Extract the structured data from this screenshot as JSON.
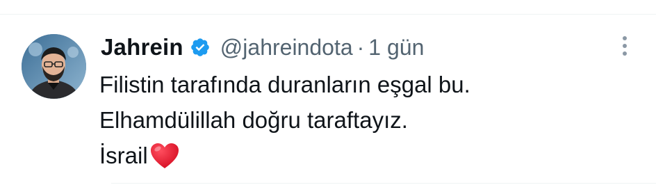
{
  "tweet": {
    "display_name": "Jahrein",
    "handle": "@jahreindota",
    "separator": "·",
    "timestamp": "1 gün",
    "verified": true,
    "verified_color": "#1d9bf0",
    "lines": [
      "Filistin tarafında duranların eşgal bu.",
      "Elhamdülillah doğru taraftayız.",
      "İsrail"
    ],
    "emoji": "red-heart-icon",
    "emoji_color": "#e1142b",
    "more_icon": "three-dots-vertical-icon",
    "avatar": "avatar-icon"
  }
}
